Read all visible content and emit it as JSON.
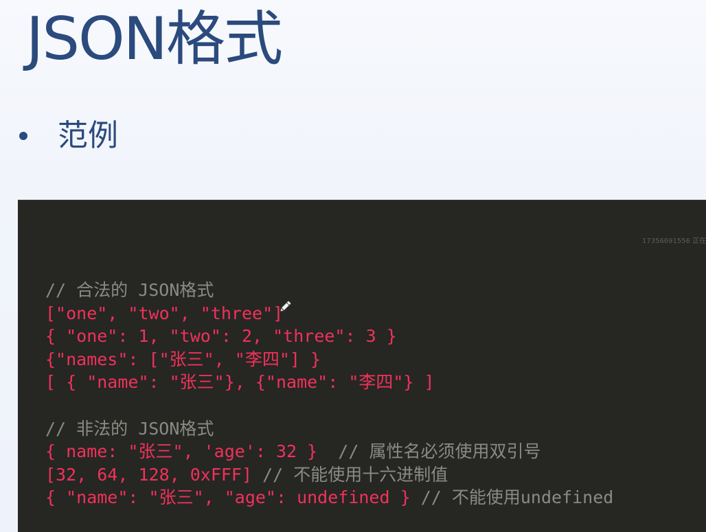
{
  "slide": {
    "title": "JSON格式",
    "bullet": "范例"
  },
  "watermark": "17356691556 正在",
  "code": {
    "legal_comment": "// 合法的 JSON格式",
    "legal_lines": [
      "[\"one\", \"two\", \"three\"]",
      "{ \"one\": 1, \"two\": 2, \"three\": 3 }",
      "{\"names\": [\"张三\", \"李四\"] }",
      "[ { \"name\": \"张三\"}, {\"name\": \"李四\"} ]"
    ],
    "illegal_comment": "// 非法的 JSON格式",
    "illegal_lines": [
      {
        "code": "{ name: \"张三\", 'age': 32 }",
        "comment": "  // 属性名必须使用双引号"
      },
      {
        "code": "[32, 64, 128, 0xFFF]",
        "comment": " // 不能使用十六进制值"
      },
      {
        "code": "{ \"name\": \"张三\", \"age\": undefined }",
        "comment": " // 不能使用undefined"
      }
    ]
  },
  "colors": {
    "title": "#2b4a7d",
    "code_background": "#262623",
    "code_text": "#f0325a",
    "comment_text": "#8a8a85"
  },
  "icons": [
    "pen-cursor-icon"
  ]
}
